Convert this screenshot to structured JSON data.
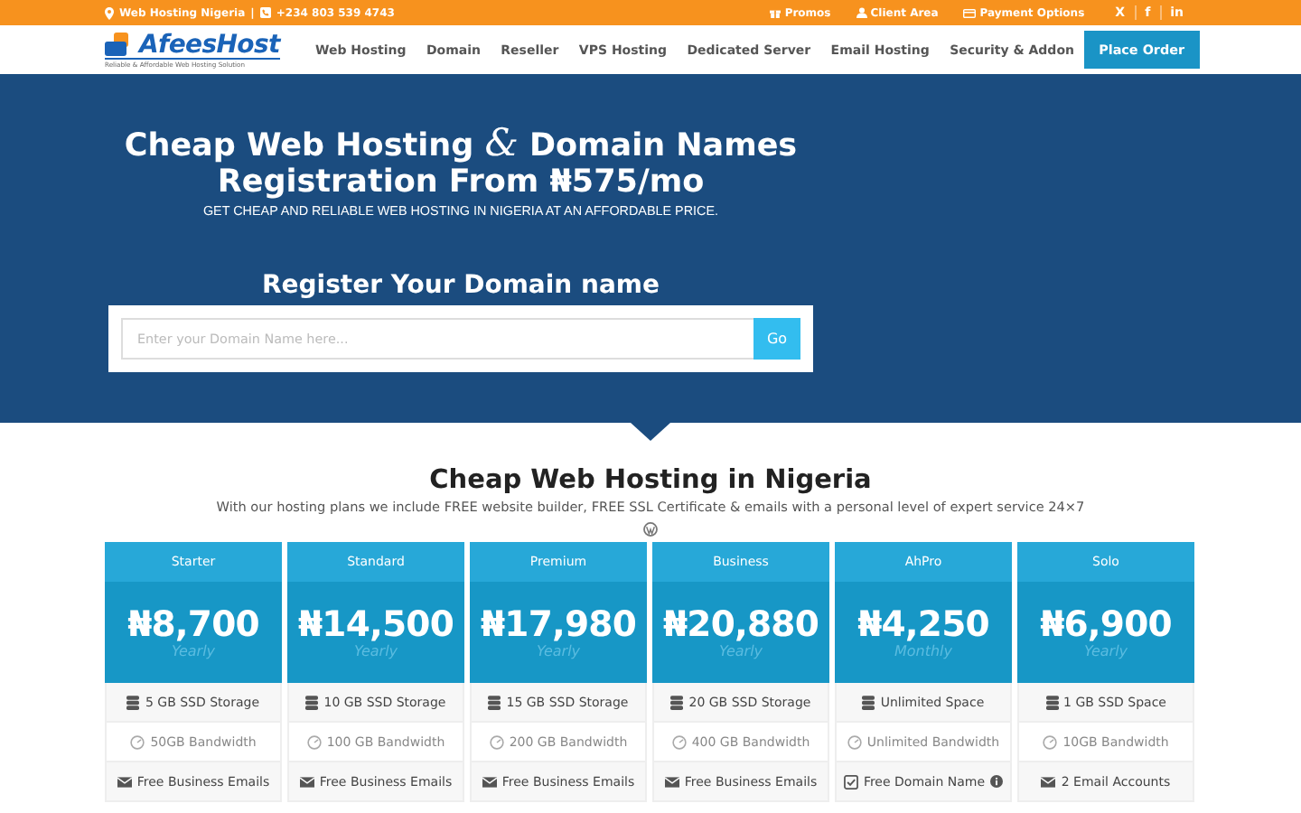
{
  "topbar": {
    "location": "Web Hosting Nigeria",
    "separator": "|",
    "phone": "+234 803 539 4743",
    "links": [
      {
        "kind": "gift",
        "label": "Promos"
      },
      {
        "kind": "user",
        "label": "Client Area"
      },
      {
        "kind": "card",
        "label": "Payment Options"
      }
    ],
    "social": [
      "X",
      "f",
      "in"
    ]
  },
  "logo": {
    "name": "AfeesHost",
    "tagline": "Reliable & Affordable Web Hosting Solution"
  },
  "nav": {
    "items": [
      "Web Hosting",
      "Domain",
      "Reseller",
      "VPS Hosting",
      "Dedicated Server",
      "Email Hosting",
      "Security & Addon"
    ],
    "cta": "Place Order"
  },
  "hero": {
    "title_start": "Cheap Web Hosting",
    "ampersand": "&",
    "title_end": "Domain Names Registration From ₦575/mo",
    "subtitle": "GET CHEAP AND RELIABLE WEB HOSTING IN NIGERIA AT AN AFFORDABLE PRICE.",
    "domain_heading": "Register Your Domain name",
    "search": {
      "placeholder": "Enter your Domain Name here...",
      "button": "Go"
    }
  },
  "plans_section": {
    "title": "Cheap Web Hosting in Nigeria",
    "subtitle": "With our hosting plans we include FREE website builder, FREE SSL Certificate & emails with a personal level of expert service 24×7"
  },
  "plans": [
    {
      "name": "Starter",
      "price": "₦8,700",
      "period": "Yearly",
      "features": [
        {
          "kind": "storage",
          "text": "5 GB SSD Storage"
        },
        {
          "kind": "bandwidth",
          "text": "50GB Bandwidth"
        },
        {
          "kind": "email",
          "text": "Free Business Emails"
        }
      ]
    },
    {
      "name": "Standard",
      "price": "₦14,500",
      "period": "Yearly",
      "features": [
        {
          "kind": "storage",
          "text": "10 GB SSD Storage"
        },
        {
          "kind": "bandwidth",
          "text": "100 GB Bandwidth"
        },
        {
          "kind": "email",
          "text": "Free Business Emails"
        }
      ]
    },
    {
      "name": "Premium",
      "price": "₦17,980",
      "period": "Yearly",
      "features": [
        {
          "kind": "storage",
          "text": "15 GB SSD Storage"
        },
        {
          "kind": "bandwidth",
          "text": "200 GB Bandwidth"
        },
        {
          "kind": "email",
          "text": "Free Business Emails"
        }
      ]
    },
    {
      "name": "Business",
      "price": "₦20,880",
      "period": "Yearly",
      "features": [
        {
          "kind": "storage",
          "text": "20 GB SSD Storage"
        },
        {
          "kind": "bandwidth",
          "text": "400 GB Bandwidth"
        },
        {
          "kind": "email",
          "text": "Free Business Emails"
        }
      ]
    },
    {
      "name": "AhPro",
      "price": "₦4,250",
      "period": "Monthly",
      "features": [
        {
          "kind": "storage",
          "text": "Unlimited Space"
        },
        {
          "kind": "bandwidth",
          "text": "Unlimited Bandwidth"
        },
        {
          "kind": "domain",
          "text": "Free Domain Name",
          "info": true
        }
      ]
    },
    {
      "name": "Solo",
      "price": "₦6,900",
      "period": "Yearly",
      "features": [
        {
          "kind": "storage",
          "text": "1 GB SSD Space"
        },
        {
          "kind": "bandwidth",
          "text": "10GB Bandwidth"
        },
        {
          "kind": "email",
          "text": "2 Email Accounts"
        }
      ]
    }
  ]
}
